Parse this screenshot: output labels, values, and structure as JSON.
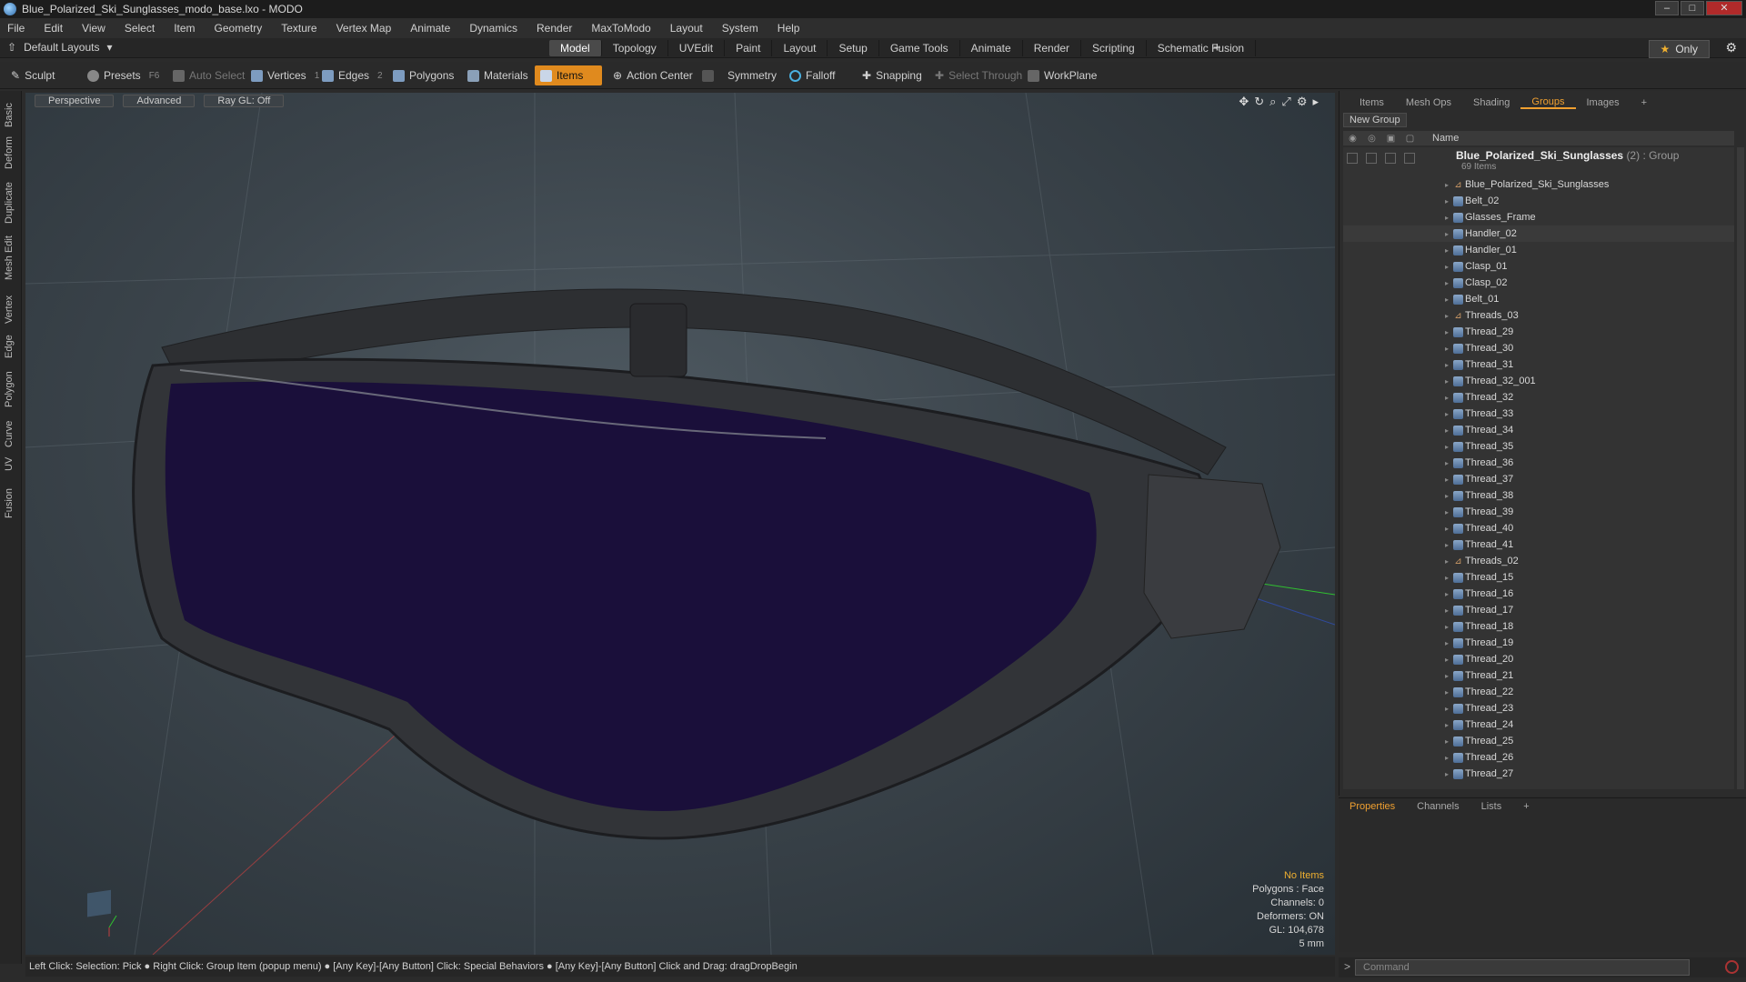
{
  "window": {
    "title": "Blue_Polarized_Ski_Sunglasses_modo_base.lxo - MODO"
  },
  "menu": [
    "File",
    "Edit",
    "View",
    "Select",
    "Item",
    "Geometry",
    "Texture",
    "Vertex Map",
    "Animate",
    "Dynamics",
    "Render",
    "MaxToModo",
    "Layout",
    "System",
    "Help"
  ],
  "layouts": {
    "selector": "Default Layouts",
    "tabs": [
      "Model",
      "Topology",
      "UVEdit",
      "Paint",
      "Layout",
      "Setup",
      "Game Tools",
      "Animate",
      "Render",
      "Scripting",
      "Schematic Fusion"
    ],
    "active_tab": "Model",
    "only_label": "Only"
  },
  "toolbar": {
    "sculpt": "Sculpt",
    "presets": "Presets",
    "presets_key": "F6",
    "auto_select": "Auto Select",
    "vertices": "Vertices",
    "vertices_key": "1",
    "edges": "Edges",
    "edges_key": "2",
    "polygons": "Polygons",
    "materials": "Materials",
    "items": "Items",
    "action_center": "Action Center",
    "symmetry": "Symmetry",
    "falloff": "Falloff",
    "snapping": "Snapping",
    "select_through": "Select Through",
    "workplane": "WorkPlane"
  },
  "left_tabs": [
    "Basic",
    "Deform",
    "Duplicate",
    "Mesh Edit",
    "Vertex",
    "Edge",
    "Polygon",
    "Curve",
    "UV",
    "Fusion"
  ],
  "viewport": {
    "view_mode": "Perspective",
    "shading": "Advanced",
    "raygl": "Ray GL: Off",
    "info": {
      "selection": "No Items",
      "polygons": "Polygons : Face",
      "channels": "Channels: 0",
      "deformers": "Deformers: ON",
      "gl": "GL: 104,678",
      "unit": "5 mm"
    }
  },
  "status_bar": "Left Click: Selection: Pick ● Right Click: Group Item (popup menu) ● [Any Key]-[Any Button] Click: Special Behaviors ● [Any Key]-[Any Button] Click and Drag: dragDropBegin",
  "right_panel": {
    "tabs": [
      "Items",
      "Mesh Ops",
      "Shading",
      "Groups",
      "Images"
    ],
    "active_tab": "Groups",
    "new_group": "New Group",
    "column_name": "Name",
    "group": {
      "name": "Blue_Polarized_Ski_Sunglasses",
      "count": "(2)",
      "type": ": Group",
      "items": "69 Items"
    },
    "rows": [
      {
        "name": "Blue_Polarized_Ski_Sunglasses",
        "icon": "locator"
      },
      {
        "name": "Belt_02",
        "icon": "mesh"
      },
      {
        "name": "Glasses_Frame",
        "icon": "mesh"
      },
      {
        "name": "Handler_02",
        "icon": "mesh"
      },
      {
        "name": "Handler_01",
        "icon": "mesh"
      },
      {
        "name": "Clasp_01",
        "icon": "mesh"
      },
      {
        "name": "Clasp_02",
        "icon": "mesh"
      },
      {
        "name": "Belt_01",
        "icon": "mesh"
      },
      {
        "name": "Threads_03",
        "icon": "locator"
      },
      {
        "name": "Thread_29",
        "icon": "mesh"
      },
      {
        "name": "Thread_30",
        "icon": "mesh"
      },
      {
        "name": "Thread_31",
        "icon": "mesh"
      },
      {
        "name": "Thread_32_001",
        "icon": "mesh"
      },
      {
        "name": "Thread_32",
        "icon": "mesh"
      },
      {
        "name": "Thread_33",
        "icon": "mesh"
      },
      {
        "name": "Thread_34",
        "icon": "mesh"
      },
      {
        "name": "Thread_35",
        "icon": "mesh"
      },
      {
        "name": "Thread_36",
        "icon": "mesh"
      },
      {
        "name": "Thread_37",
        "icon": "mesh"
      },
      {
        "name": "Thread_38",
        "icon": "mesh"
      },
      {
        "name": "Thread_39",
        "icon": "mesh"
      },
      {
        "name": "Thread_40",
        "icon": "mesh"
      },
      {
        "name": "Thread_41",
        "icon": "mesh"
      },
      {
        "name": "Threads_02",
        "icon": "locator"
      },
      {
        "name": "Thread_15",
        "icon": "mesh"
      },
      {
        "name": "Thread_16",
        "icon": "mesh"
      },
      {
        "name": "Thread_17",
        "icon": "mesh"
      },
      {
        "name": "Thread_18",
        "icon": "mesh"
      },
      {
        "name": "Thread_19",
        "icon": "mesh"
      },
      {
        "name": "Thread_20",
        "icon": "mesh"
      },
      {
        "name": "Thread_21",
        "icon": "mesh"
      },
      {
        "name": "Thread_22",
        "icon": "mesh"
      },
      {
        "name": "Thread_23",
        "icon": "mesh"
      },
      {
        "name": "Thread_24",
        "icon": "mesh"
      },
      {
        "name": "Thread_25",
        "icon": "mesh"
      },
      {
        "name": "Thread_26",
        "icon": "mesh"
      },
      {
        "name": "Thread_27",
        "icon": "mesh"
      }
    ]
  },
  "bottom_panel": {
    "tabs": [
      "Properties",
      "Channels",
      "Lists"
    ],
    "active_tab": "Properties"
  },
  "command": {
    "placeholder": "Command"
  },
  "colors": {
    "accent": "#e08a1e",
    "tab_active": "#f0a030",
    "lens": "#1a0f3a"
  }
}
